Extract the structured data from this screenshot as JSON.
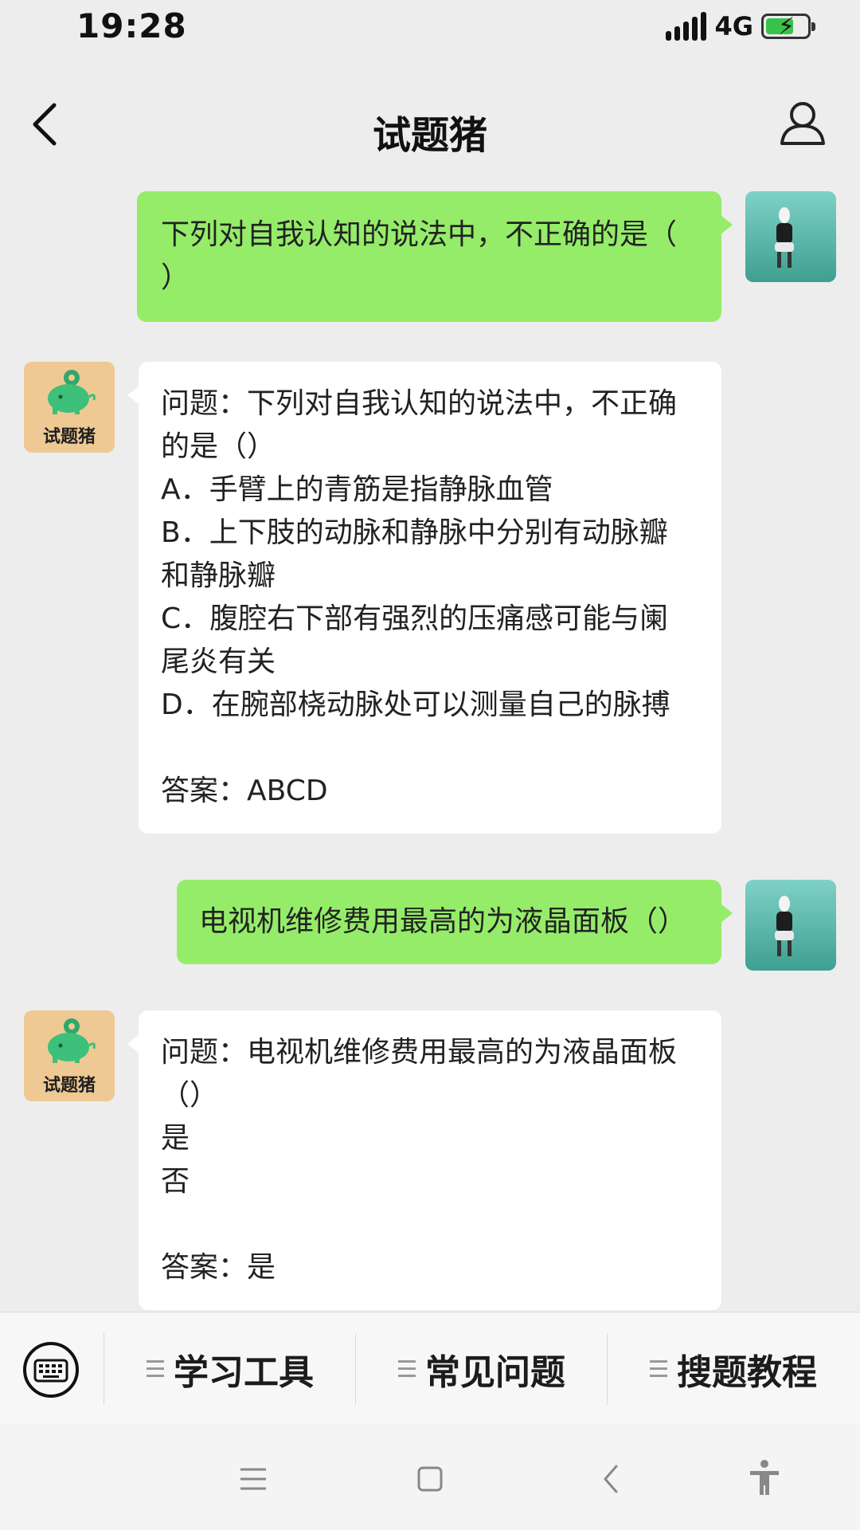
{
  "status_bar": {
    "time": "19:28",
    "network": "4G",
    "battery_charging": true,
    "battery_level": 0.6
  },
  "header": {
    "title": "试题猪"
  },
  "bot": {
    "avatar_label": "试题猪"
  },
  "messages": [
    {
      "sender": "user",
      "text": "下列对自我认知的说法中，不正确的是（\n）"
    },
    {
      "sender": "bot",
      "text": "问题：下列对自我认知的说法中，不正确\n的是（）\nA．手臂上的青筋是指静脉血管\nB．上下肢的动脉和静脉中分别有动脉瓣\n和静脉瓣\nC．腹腔右下部有强烈的压痛感可能与阑\n尾炎有关\nD．在腕部桡动脉处可以测量自己的脉搏\n\n答案：ABCD"
    },
    {
      "sender": "user",
      "text": "电视机维修费用最高的为液晶面板（）"
    },
    {
      "sender": "bot",
      "text": "问题：电视机维修费用最高的为液晶面板\n（）\n是\n否\n\n答案：是"
    }
  ],
  "menu": {
    "items": [
      {
        "label": "学习工具"
      },
      {
        "label": "常见问题"
      },
      {
        "label": "搜题教程"
      }
    ]
  },
  "colors": {
    "background": "#ededed",
    "user_bubble": "#95ec69",
    "bot_bubble": "#ffffff",
    "bot_avatar": "#efc993"
  }
}
